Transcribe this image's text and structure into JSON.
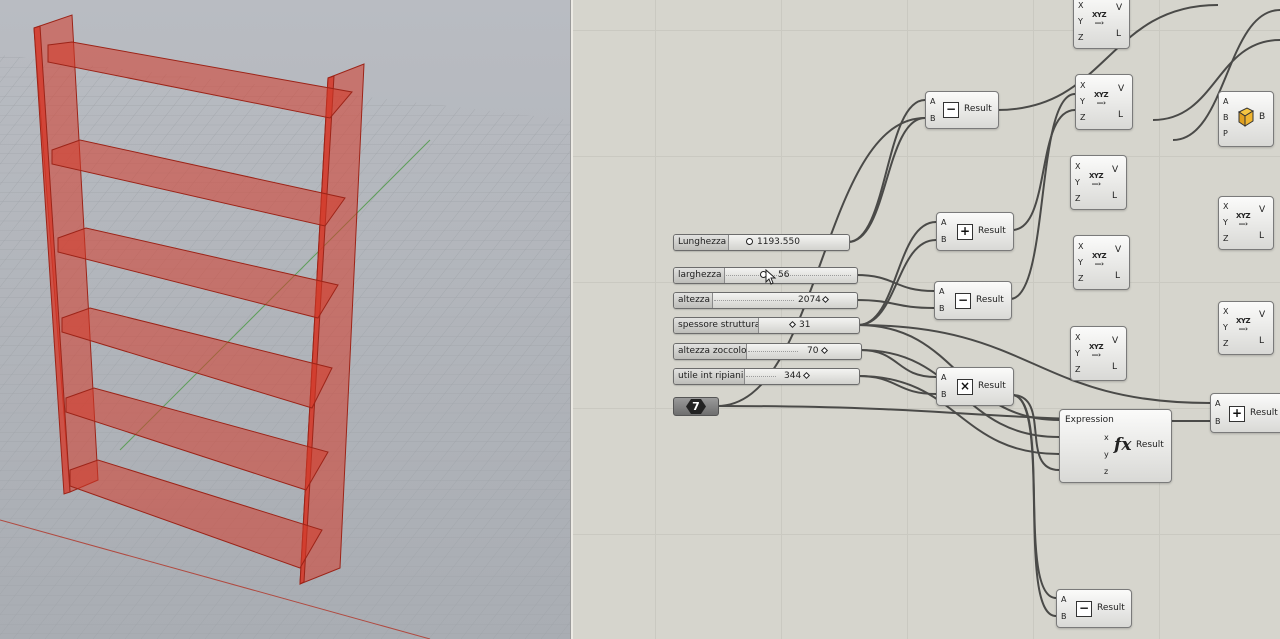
{
  "sliders": [
    {
      "id": "lunghezza",
      "label": "Lunghezza",
      "value": "1193.550"
    },
    {
      "id": "larghezza",
      "label": "larghezza",
      "value": "56"
    },
    {
      "id": "altezza",
      "label": "altezza",
      "value": "2074"
    },
    {
      "id": "spessore",
      "label": "spessore struttura",
      "value": "31"
    },
    {
      "id": "zoccolo",
      "label": "altezza zoccolo",
      "value": "70"
    },
    {
      "id": "ripiani",
      "label": "utile int ripiani",
      "value": "344"
    }
  ],
  "integer_param": {
    "value": "7"
  },
  "ops": [
    {
      "id": "sub1",
      "symbol": "−",
      "a": "A",
      "b": "B",
      "result": "Result"
    },
    {
      "id": "add1",
      "symbol": "+",
      "a": "A",
      "b": "B",
      "result": "Result"
    },
    {
      "id": "sub2",
      "symbol": "−",
      "a": "A",
      "b": "B",
      "result": "Result"
    },
    {
      "id": "mul1",
      "symbol": "×",
      "a": "A",
      "b": "B",
      "result": "Result"
    },
    {
      "id": "add2",
      "symbol": "+",
      "a": "A",
      "b": "B",
      "result": "Result"
    },
    {
      "id": "sub3",
      "symbol": "−",
      "a": "A",
      "b": "B",
      "result": "Result"
    }
  ],
  "expression": {
    "title": "Expression",
    "inputs": [
      "x",
      "y",
      "z"
    ],
    "output": "Result"
  },
  "vector_components": {
    "inputs": [
      "X",
      "Y",
      "Z"
    ],
    "outputs": [
      "V",
      "L"
    ],
    "icon": "XYZ"
  },
  "box_component": {
    "inputs": [
      "A",
      "B",
      "P"
    ],
    "output": "B"
  },
  "colors": {
    "viewport_bg": "#b4b8bf",
    "shelf": "#c8392b",
    "canvas_bg": "#d6d5cd",
    "wire": "#4a4a48"
  }
}
